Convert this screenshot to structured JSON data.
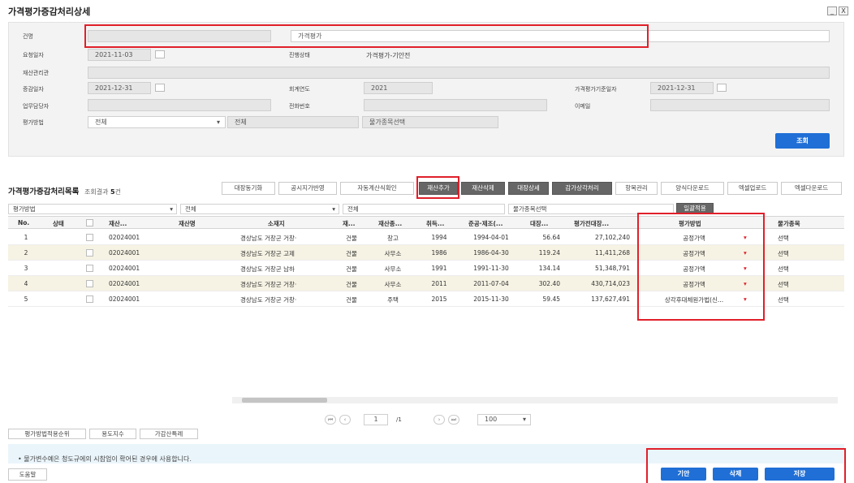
{
  "window": {
    "title": "가격평가증감처리상세",
    "minimize": "_",
    "close": "X"
  },
  "form": {
    "subject_label": "건명",
    "subject_value": "가격평가",
    "request_date_label": "요청일자",
    "request_date": "2021-11-03",
    "progress_label": "진행상태",
    "progress_value": "가격평가-기안전",
    "asset_manager_label": "재산관리관",
    "change_date_label": "증감일자",
    "change_date": "2021-12-31",
    "fiscal_year_label": "회계연도",
    "fiscal_year": "2021",
    "eval_base_date_label": "가격평가기준일자",
    "eval_base_date": "2021-12-31",
    "staff_label": "업무담당자",
    "phone_label": "전화번호",
    "email_label": "이메일",
    "method_label": "평가방법",
    "method_value": "전체",
    "method2_value": "전체",
    "item_select_value": "물가종목선택",
    "search_button": "조회"
  },
  "list": {
    "title": "가격평가증감처리목록",
    "result_prefix": "조회결과",
    "result_count": "5",
    "result_unit": "건",
    "toolbar": [
      "대장동기화",
      "공시지가반영",
      "자동계산식확인",
      "재산추가",
      "재산삭제",
      "대장상세",
      "감가상각처리",
      "항목관리",
      "양식다운로드",
      "엑셀업로드",
      "엑셀다운로드"
    ],
    "filter": {
      "method_label": "평가방법",
      "method_value": "전체",
      "value2": "전체",
      "item_select": "물가종목선택",
      "apply_button": "일괄적용"
    },
    "headers": [
      "No.",
      "상태",
      "재산...",
      "재산명",
      "소재지",
      "재...",
      "재산종...",
      "취득...",
      "준공·제조(...",
      "대장...",
      "평가전대장...",
      "평가방법",
      "물가종목"
    ],
    "rows": [
      {
        "no": "1",
        "code": "02024001",
        "location": "경상남도 거창군 거창·",
        "kind": "건물",
        "type": "창고",
        "year": "1994",
        "built": "1994-04-01",
        "area": "56.64",
        "amount": "27,102,240",
        "method": "공정가액",
        "item": "선택"
      },
      {
        "no": "2",
        "code": "02024001",
        "location": "경상남도 거창군 고제",
        "kind": "건물",
        "type": "사무소",
        "year": "1986",
        "built": "1986-04-30",
        "area": "119.24",
        "amount": "11,411,268",
        "method": "공정가액",
        "item": "선택"
      },
      {
        "no": "3",
        "code": "02024001",
        "location": "경상남도 거창군 남하",
        "kind": "건물",
        "type": "사무소",
        "year": "1991",
        "built": "1991-11-30",
        "area": "134.14",
        "amount": "51,348,791",
        "method": "공정가액",
        "item": "선택"
      },
      {
        "no": "4",
        "code": "02024001",
        "location": "경상남도 거창군 거창·",
        "kind": "건물",
        "type": "사무소",
        "year": "2011",
        "built": "2011-07-04",
        "area": "302.40",
        "amount": "430,714,023",
        "method": "공정가액",
        "item": "선택"
      },
      {
        "no": "5",
        "code": "02024001",
        "location": "경상남도 거창군 거창·",
        "kind": "건물",
        "type": "주택",
        "year": "2015",
        "built": "2015-11-30",
        "area": "59.45",
        "amount": "137,627,491",
        "method": "상각후대체원가법(신...",
        "item": "선택"
      }
    ]
  },
  "pager": {
    "page": "1",
    "total": "/1",
    "page_size": "100"
  },
  "bottom_tools": [
    "평가방법적용순위",
    "용도지수",
    "가감산특례"
  ],
  "info_text": "• 물가변수예은 청도규에의 시참업이 확어된 경우에 사용합니다.",
  "footer": {
    "help": "도움말",
    "draft": "기안",
    "delete": "삭제",
    "save": "저장"
  },
  "colors": {
    "primary": "#1f6fd6",
    "highlight": "#e0202a",
    "stripe": "#f6f3e4"
  }
}
